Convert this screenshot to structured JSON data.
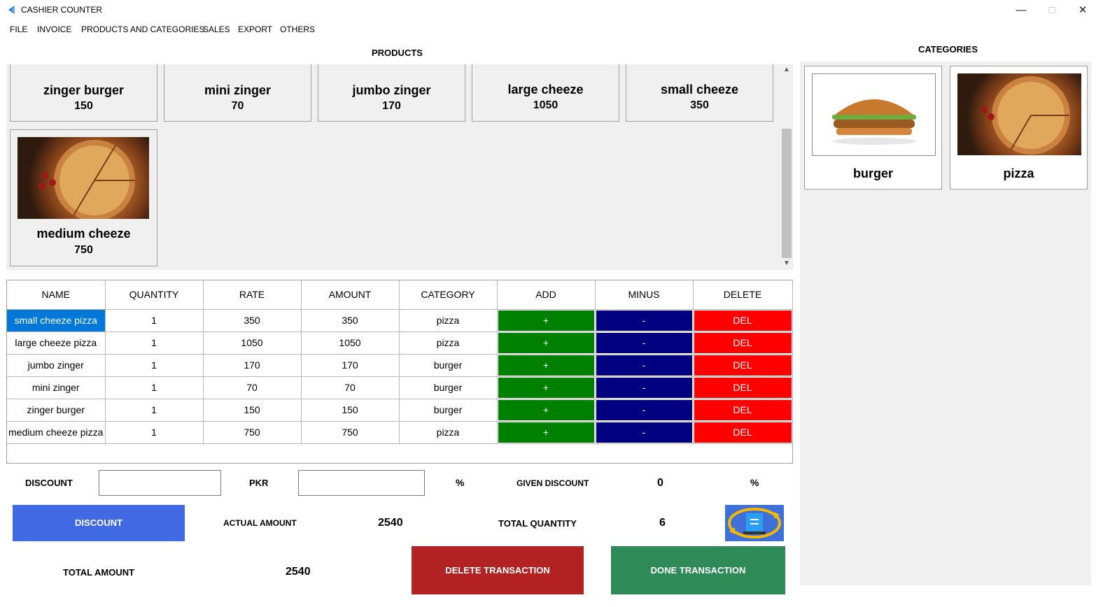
{
  "window": {
    "title": "CASHIER COUNTER"
  },
  "menu": [
    "FILE",
    "INVOICE",
    "PRODUCTS AND CATEGORIES",
    "SALES",
    "EXPORT",
    "OTHERS"
  ],
  "products_title": "PRODUCTS",
  "categories_title": "CATEGORIES",
  "products": [
    {
      "name": "zinger burger",
      "price": "150"
    },
    {
      "name": "mini zinger",
      "price": "70"
    },
    {
      "name": "jumbo zinger",
      "price": "170"
    },
    {
      "name": "large cheeze",
      "price": "1050"
    },
    {
      "name": "small cheeze",
      "price": "350"
    },
    {
      "name": "medium cheeze",
      "price": "750"
    }
  ],
  "categories": [
    {
      "name": "burger"
    },
    {
      "name": "pizza"
    }
  ],
  "table": {
    "headers": [
      "NAME",
      "QUANTITY",
      "RATE",
      "AMOUNT",
      "CATEGORY",
      "ADD",
      "MINUS",
      "DELETE"
    ],
    "rows": [
      {
        "name": "small cheeze pizza",
        "quantity": "1",
        "rate": "350",
        "amount": "350",
        "category": "pizza",
        "add": "+",
        "minus": "-",
        "del": "DEL"
      },
      {
        "name": "large cheeze pizza",
        "quantity": "1",
        "rate": "1050",
        "amount": "1050",
        "category": "pizza",
        "add": "+",
        "minus": "-",
        "del": "DEL"
      },
      {
        "name": "jumbo zinger",
        "quantity": "1",
        "rate": "170",
        "amount": "170",
        "category": "burger",
        "add": "+",
        "minus": "-",
        "del": "DEL"
      },
      {
        "name": "mini zinger",
        "quantity": "1",
        "rate": "70",
        "amount": "70",
        "category": "burger",
        "add": "+",
        "minus": "-",
        "del": "DEL"
      },
      {
        "name": "zinger burger",
        "quantity": "1",
        "rate": "150",
        "amount": "150",
        "category": "burger",
        "add": "+",
        "minus": "-",
        "del": "DEL"
      },
      {
        "name": "medium cheeze pizza",
        "quantity": "1",
        "rate": "750",
        "amount": "750",
        "category": "pizza",
        "add": "+",
        "minus": "-",
        "del": "DEL"
      }
    ]
  },
  "summary": {
    "discount_label": "DISCOUNT",
    "pkr_label": "PKR",
    "percent_sign": "%",
    "given_discount_label": "GIVEN DISCOUNT",
    "given_discount_value": "0",
    "given_percent_sign": "%",
    "discount_button": "DISCOUNT",
    "actual_amount_label": "ACTUAL AMOUNT",
    "actual_amount_value": "2540",
    "total_quantity_label": "TOTAL QUANTITY",
    "total_quantity_value": "6",
    "total_amount_label": "TOTAL AMOUNT",
    "total_amount_value": "2540",
    "delete_transaction_button": "DELETE TRANSACTION",
    "done_transaction_button": "DONE TRANSACTION"
  },
  "colors": {
    "add": "#008000",
    "minus": "#000080",
    "delete": "#ff0000",
    "selection": "#0078d7",
    "discount_button": "#4169e1",
    "delete_transaction": "#b22222",
    "done_transaction": "#2e8b57"
  }
}
